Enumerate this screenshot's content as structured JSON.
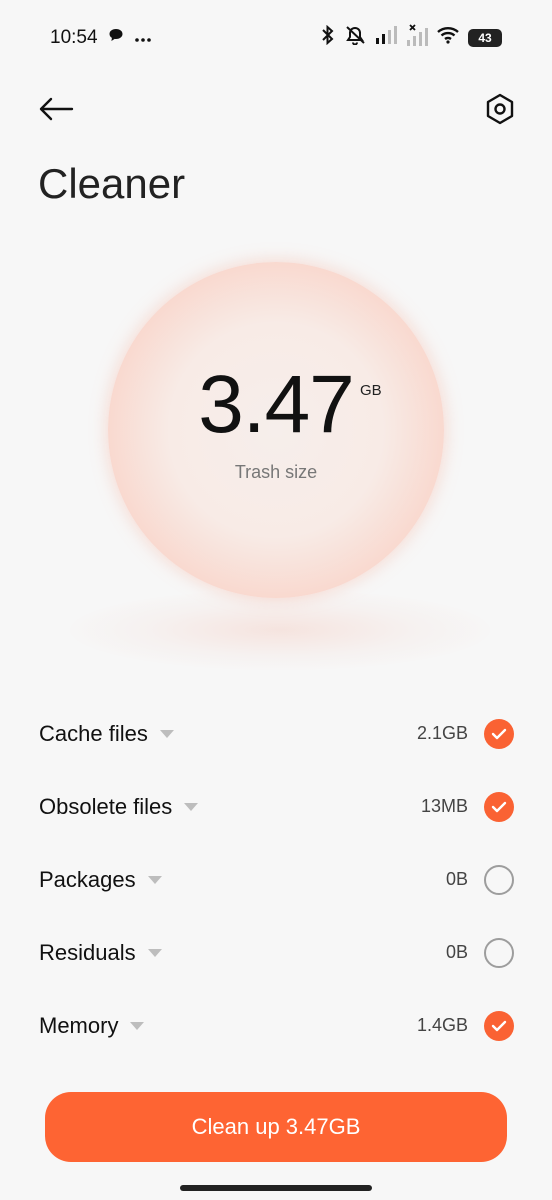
{
  "status_bar": {
    "time": "10:54",
    "notification_icons": [
      "chat-bubble-icon",
      "more-dots-icon"
    ],
    "right_icons": [
      "bluetooth-icon",
      "mute-icon",
      "signal-icon",
      "signal-no-service-icon",
      "wifi-icon"
    ],
    "battery_level": "43"
  },
  "header": {
    "back_icon": "arrow-left-icon",
    "settings_icon": "settings-hexagon-icon",
    "title": "Cleaner"
  },
  "summary": {
    "trash_value": "3.47",
    "trash_unit": "GB",
    "trash_label": "Trash size"
  },
  "items": [
    {
      "label": "Cache files",
      "size": "2.1GB",
      "checked": true
    },
    {
      "label": "Obsolete files",
      "size": "13MB",
      "checked": true
    },
    {
      "label": "Packages",
      "size": "0B",
      "checked": false
    },
    {
      "label": "Residuals",
      "size": "0B",
      "checked": false
    },
    {
      "label": "Memory",
      "size": "1.4GB",
      "checked": true
    }
  ],
  "action": {
    "clean_label": "Clean up 3.47GB"
  },
  "colors": {
    "accent": "#fe6433",
    "background": "#f7f7f7"
  }
}
